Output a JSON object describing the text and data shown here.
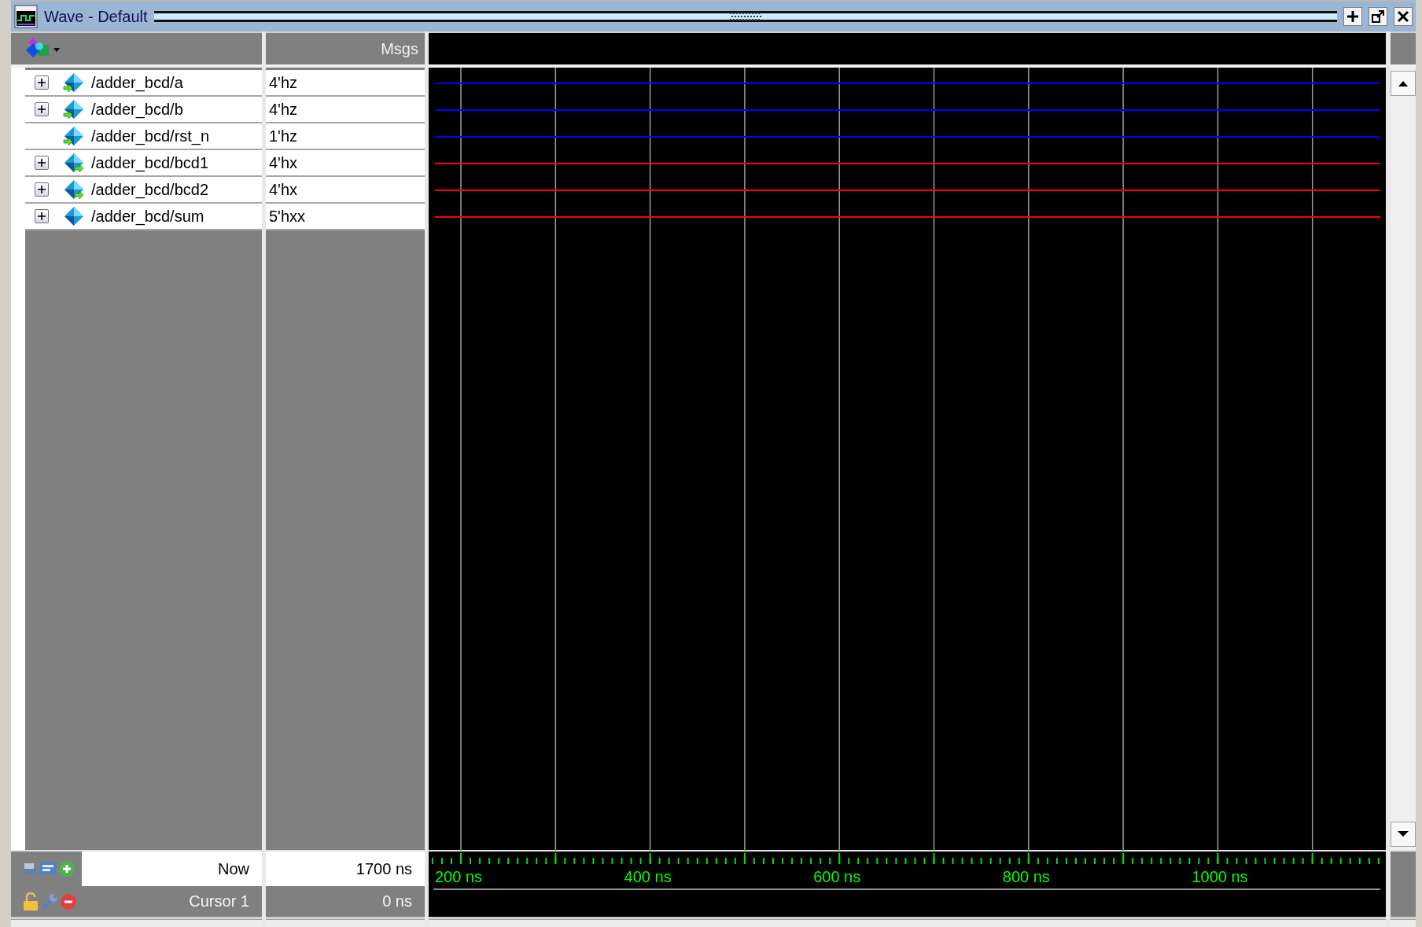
{
  "window": {
    "title": "Wave - Default"
  },
  "values_header": "Msgs",
  "signals": [
    {
      "name": "/adder_bcd/a",
      "value": "4'hz",
      "expandable": true,
      "kind": "input",
      "color": "#0000ff"
    },
    {
      "name": "/adder_bcd/b",
      "value": "4'hz",
      "expandable": true,
      "kind": "input",
      "color": "#0000ff"
    },
    {
      "name": "/adder_bcd/rst_n",
      "value": "1'hz",
      "expandable": false,
      "kind": "input",
      "color": "#0000ff"
    },
    {
      "name": "/adder_bcd/bcd1",
      "value": "4'hx",
      "expandable": true,
      "kind": "output",
      "color": "#ff0000"
    },
    {
      "name": "/adder_bcd/bcd2",
      "value": "4'hx",
      "expandable": true,
      "kind": "output",
      "color": "#ff0000"
    },
    {
      "name": "/adder_bcd/sum",
      "value": "5'hxx",
      "expandable": true,
      "kind": "internal",
      "color": "#ff0000"
    }
  ],
  "footer": {
    "now_label": "Now",
    "now_value": "1700 ns",
    "cursor_label": "Cursor 1",
    "cursor_value": "0 ns"
  },
  "ruler": {
    "labels": [
      "200 ns",
      "400 ns",
      "600 ns",
      "800 ns",
      "1000 ns"
    ]
  }
}
